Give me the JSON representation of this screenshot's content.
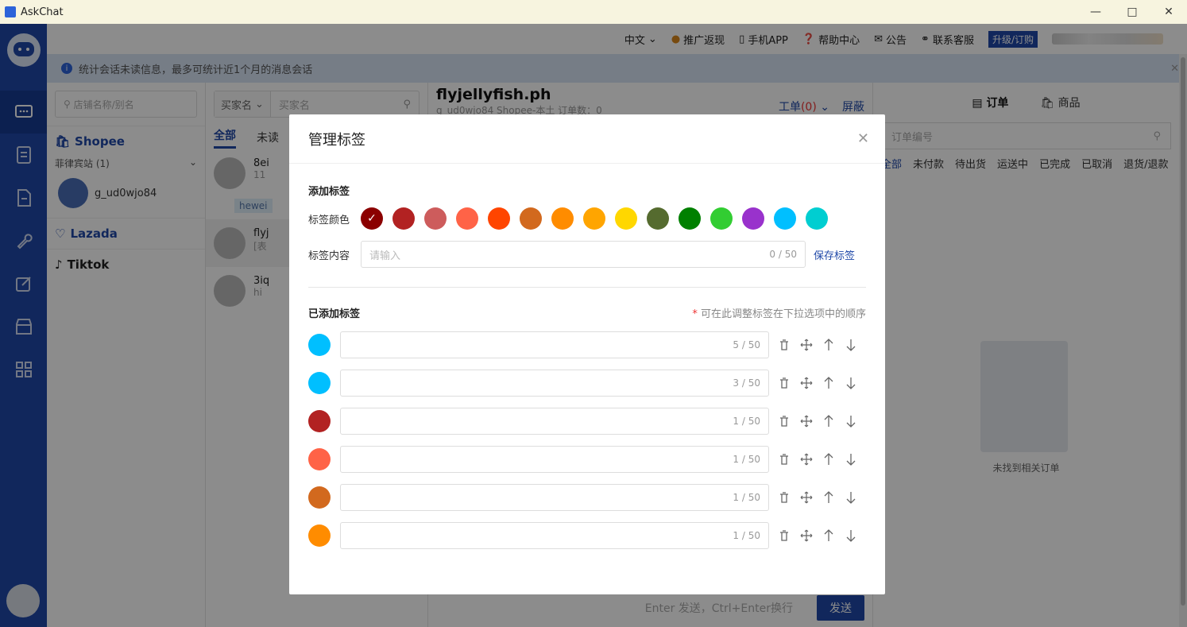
{
  "window": {
    "title": "AskChat"
  },
  "topbar": {
    "lang": "中文",
    "promo": "推广返现",
    "app": "手机APP",
    "help": "帮助中心",
    "notice": "公告",
    "support": "联系客服",
    "upgrade": "升级/订购"
  },
  "notice_bar": {
    "text": "统计会话未读信息，最多可统计近1个月的消息会话"
  },
  "shops_panel": {
    "search_placeholder": "店铺名称/别名",
    "platforms": [
      {
        "name": "Shopee",
        "group": "菲律宾站 (1)",
        "shop": "g_ud0wjo84"
      },
      {
        "name": "Lazada"
      },
      {
        "name": "Tiktok"
      }
    ]
  },
  "conversations_panel": {
    "search_select": "买家名",
    "search_placeholder": "买家名",
    "tabs": [
      "全部",
      "未读"
    ],
    "items": [
      {
        "name": "8ei",
        "sub": "11",
        "tag": "hewei"
      },
      {
        "name": "flyj",
        "sub": "[表"
      },
      {
        "name": "3iq",
        "sub": "hi"
      }
    ]
  },
  "chat_panel": {
    "title": "flyjellyfish.ph",
    "sub": "g_ud0wjo84    Shopee-本土    订单数：0",
    "ticket": "工单",
    "ticket_count": "(0)",
    "block": "屏蔽",
    "input_placeholder": "Enter 发送，Ctrl+Enter换行",
    "send": "发送"
  },
  "orders_panel": {
    "tabs": [
      "订单",
      "商品"
    ],
    "search_placeholder": "订单编号",
    "filters": [
      "全部",
      "未付款",
      "待出货",
      "运送中",
      "已完成",
      "已取消",
      "退货/退款"
    ],
    "empty_text": "未找到相关订单"
  },
  "modal": {
    "title": "管理标签",
    "add_section": "添加标签",
    "color_label": "标签颜色",
    "content_label": "标签内容",
    "content_placeholder": "请输入",
    "content_count": "0 / 50",
    "save_label": "保存标签",
    "added_section": "已添加标签",
    "hint_star": "*",
    "hint": "可在此调整标签在下拉选项中的顺序",
    "colors": [
      "#8b0000",
      "#b22222",
      "#cd5c5c",
      "#ff6347",
      "#ff4500",
      "#d2691e",
      "#ff8c00",
      "#ffa500",
      "#ffd700",
      "#556b2f",
      "#008000",
      "#32cd32",
      "#9932cc",
      "#00bfff",
      "#00ced1"
    ],
    "tags": [
      {
        "color": "#00bfff",
        "count": "5 / 50"
      },
      {
        "color": "#00bfff",
        "count": "3 / 50"
      },
      {
        "color": "#b22222",
        "count": "1 / 50"
      },
      {
        "color": "#ff6347",
        "count": "1 / 50"
      },
      {
        "color": "#d2691e",
        "count": "1 / 50"
      },
      {
        "color": "#ff8c00",
        "count": "1 / 50"
      }
    ]
  }
}
